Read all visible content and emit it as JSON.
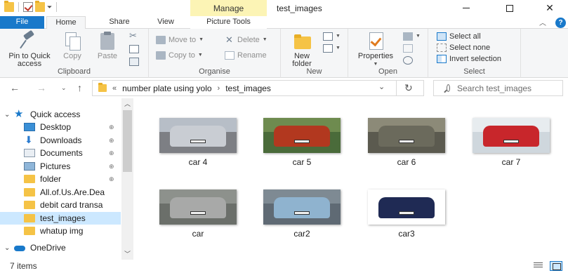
{
  "titlebar": {
    "title": "test_images",
    "manage_tab": "Manage",
    "qat_arrow": "⏷"
  },
  "tabs": {
    "file": "File",
    "home": "Home",
    "share": "Share",
    "view": "View",
    "picture_tools": "Picture Tools",
    "help": "?"
  },
  "ribbon": {
    "clipboard": {
      "label": "Clipboard",
      "pin": "Pin to Quick access",
      "copy": "Copy",
      "paste": "Paste"
    },
    "organise": {
      "label": "Organise",
      "move_to": "Move to",
      "copy_to": "Copy to",
      "delete": "Delete",
      "rename": "Rename"
    },
    "new": {
      "label": "New",
      "new_folder": "New folder"
    },
    "open": {
      "label": "Open",
      "properties": "Properties"
    },
    "select": {
      "label": "Select",
      "select_all": "Select all",
      "select_none": "Select none",
      "invert": "Invert selection"
    }
  },
  "address": {
    "overflow": "«",
    "crumbs": [
      "number plate using yolo",
      "test_images"
    ],
    "search_placeholder": "Search test_images"
  },
  "navpane": {
    "items": [
      {
        "label": "Quick access",
        "icon": "star-icon",
        "chevron": "⌄",
        "pinned": false
      },
      {
        "label": "Desktop",
        "icon": "desktop-icon",
        "pinned": true
      },
      {
        "label": "Downloads",
        "icon": "download-icon",
        "pinned": true
      },
      {
        "label": "Documents",
        "icon": "documents-icon",
        "pinned": true
      },
      {
        "label": "Pictures",
        "icon": "pictures-icon",
        "pinned": true
      },
      {
        "label": "folder",
        "icon": "folder-icon",
        "pinned": true
      },
      {
        "label": "All.of.Us.Are.Dea",
        "icon": "folder-icon",
        "pinned": false
      },
      {
        "label": "debit card transa",
        "icon": "folder-icon",
        "pinned": false
      },
      {
        "label": "test_images",
        "icon": "folder-icon",
        "pinned": false,
        "selected": true
      },
      {
        "label": "whatup img",
        "icon": "folder-icon",
        "pinned": false
      },
      {
        "label": "OneDrive",
        "icon": "onedrive-icon",
        "chevron": "⌄",
        "pinned": false
      }
    ],
    "pin_glyph": "📌"
  },
  "files": [
    {
      "name": "car 4",
      "bg": "#7d7f84",
      "car": "#c9cdd3",
      "sky": "#b7bec7"
    },
    {
      "name": "car 5",
      "bg": "#4a6b3a",
      "car": "#b2381f",
      "sky": "#6e8b4f"
    },
    {
      "name": "car 6",
      "bg": "#5b5a4f",
      "car": "#6b6a5c",
      "sky": "#8c8a78"
    },
    {
      "name": "car 7",
      "bg": "#cfd7dd",
      "car": "#c8262b",
      "sky": "#e7ecef"
    },
    {
      "name": "car",
      "bg": "#6b6f6a",
      "car": "#a8a9a8",
      "sky": "#8d918c"
    },
    {
      "name": "car2",
      "bg": "#5f6a74",
      "car": "#8fb3cf",
      "sky": "#7e8a93"
    },
    {
      "name": "car3",
      "bg": "#ffffff",
      "car": "#1f2a54",
      "sky": "#ffffff"
    }
  ],
  "status": {
    "count": "7 items"
  },
  "colors": {
    "accent": "#1979ca",
    "manage_tab": "#fcf4b5",
    "selected": "#cce8ff"
  }
}
